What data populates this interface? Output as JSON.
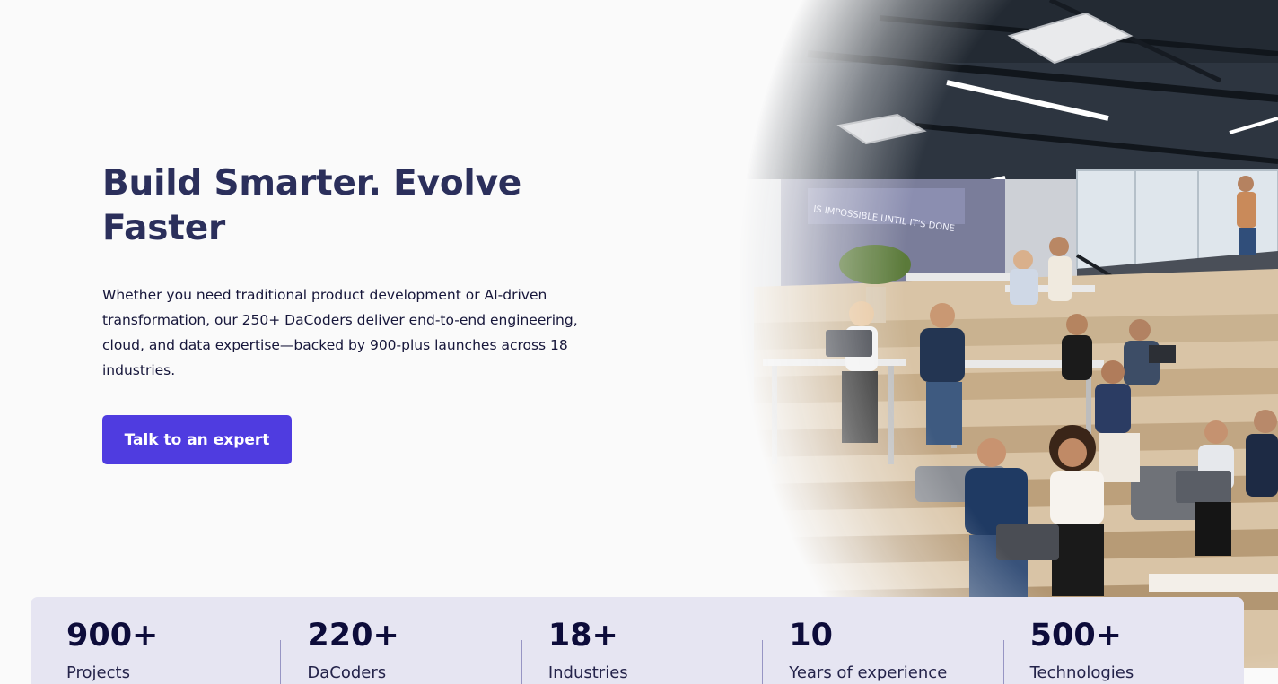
{
  "hero": {
    "title": "Build Smarter. Evolve Faster",
    "description": "Whether you need traditional product development or AI-driven transformation, our 250+ DaCoders deliver end-to-end engineering, cloud, and data expertise—backed by 900-plus launches across 18 industries.",
    "cta_label": "Talk to an expert",
    "image_sign_text": "IS IMPOSSIBLE UNTIL IT'S DONE"
  },
  "stats": [
    {
      "value": "900+",
      "label": "Projects"
    },
    {
      "value": "220+",
      "label": "DaCoders"
    },
    {
      "value": "18+",
      "label": "Industries"
    },
    {
      "value": "10",
      "label": "Years of experience"
    },
    {
      "value": "500+",
      "label": "Technologies"
    }
  ],
  "colors": {
    "background": "#fafafa",
    "title": "#2b2f5b",
    "cta": "#4f3ce0",
    "stats_bg": "#e6e5f2",
    "stat_value": "#0d0c3a"
  }
}
